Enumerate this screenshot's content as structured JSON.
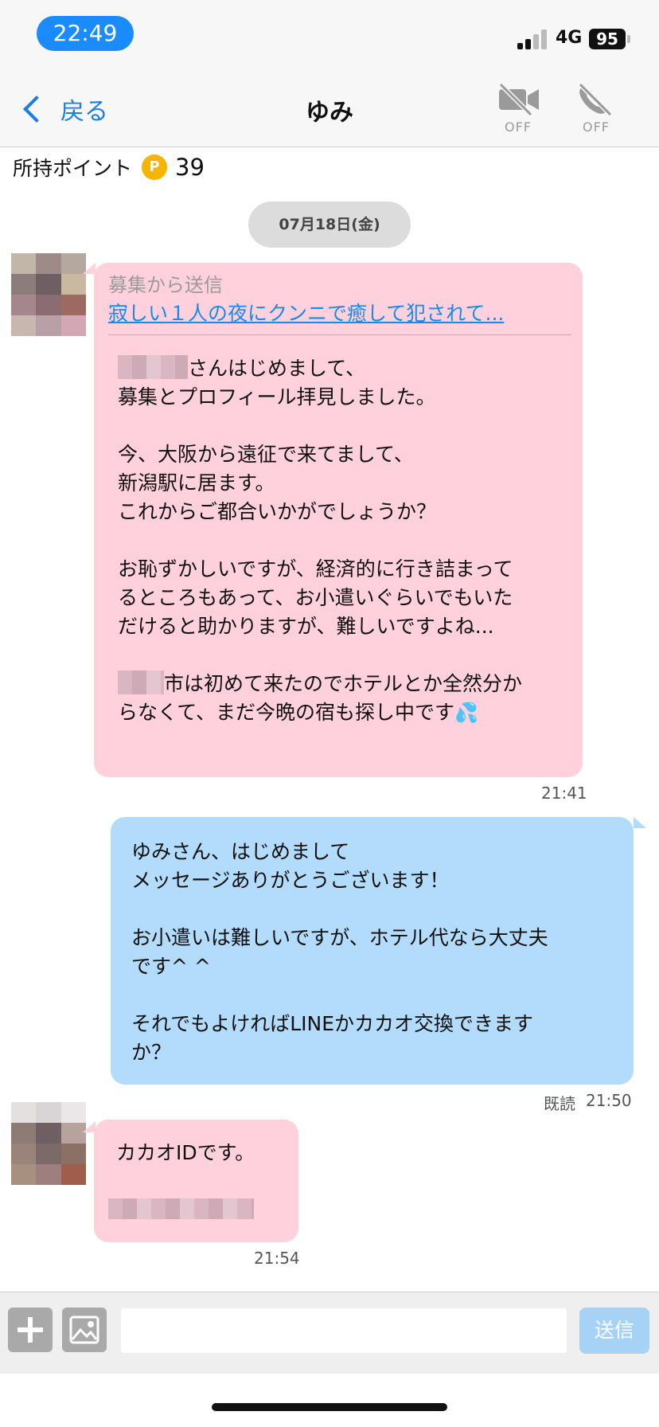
{
  "status_bar": {
    "time": "22:49",
    "network": "4G",
    "battery": "95"
  },
  "nav": {
    "back_label": "戻る",
    "title": "ゆみ",
    "video_label": "OFF",
    "call_label": "OFF"
  },
  "points": {
    "label": "所持ポイント",
    "coin": "P",
    "value": "39"
  },
  "date_chip": "07月18日(金)",
  "messages": [
    {
      "recruit_label": "募集から送信",
      "recruit_link": "寂しい１人の夜にクンニで癒して犯されて...",
      "lines": [
        "さんはじめまして、",
        "募集とプロフィール拝見しました。",
        "今、大阪から遠征で来てまして、",
        "新潟駅に居ます。",
        "これからご都合いかがでしょうか？",
        "お恥ずかしいですが、経済的に行き詰まって",
        "るところもあって、お小遣いぐらいでもいた",
        "だけると助かりますが、難しいですよね...",
        "市は初めて来たのでホテルとか全然分か",
        "らなくて、まだ今晩の宿も探し中です"
      ],
      "emoji": "💦",
      "time": "21:41"
    },
    {
      "lines": [
        "ゆみさん、はじめまして",
        "メッセージありがとうございます！",
        "お小遣いは難しいですが、ホテル代なら大丈夫",
        "です^ ^",
        "それでもよければLINEかカカオ交換できます",
        "か？"
      ],
      "read": "既読",
      "time": "21:50"
    },
    {
      "lines": [
        "カカオIDです。"
      ],
      "time": "21:54"
    }
  ],
  "input": {
    "placeholder": "",
    "send_label": "送信"
  }
}
